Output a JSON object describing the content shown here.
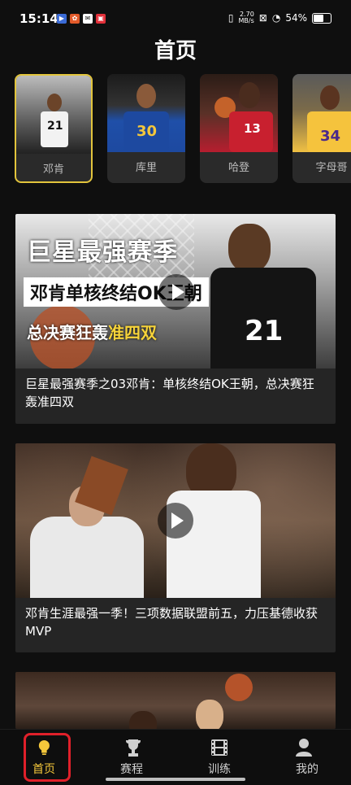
{
  "status_bar": {
    "time": "15:14",
    "net_speed_value": "2.70",
    "net_speed_unit": "MB/s",
    "battery": "54%"
  },
  "page": {
    "title": "首页"
  },
  "players": [
    {
      "name": "邓肯",
      "selected": true
    },
    {
      "name": "库里",
      "selected": false
    },
    {
      "name": "哈登",
      "selected": false
    },
    {
      "name": "字母哥",
      "selected": false
    }
  ],
  "videos": [
    {
      "title": "巨星最强赛季之03邓肯：单核终结OK王朝，总决赛狂轰准四双",
      "overlay_line1": "巨星最强赛季",
      "overlay_line2": "邓肯单核终结OK王朝",
      "overlay_line3a": "总决赛狂轰",
      "overlay_line3b": "准四双",
      "jersey": "21"
    },
    {
      "title": "邓肯生涯最强一季！三项数据联盟前五，力压基德收获MVP"
    },
    {
      "title": ""
    }
  ],
  "nav": {
    "home": "首页",
    "schedule": "赛程",
    "training": "训练",
    "mine": "我的"
  },
  "colors": {
    "accent": "#f4c73b",
    "highlight_border": "#e0202a"
  }
}
